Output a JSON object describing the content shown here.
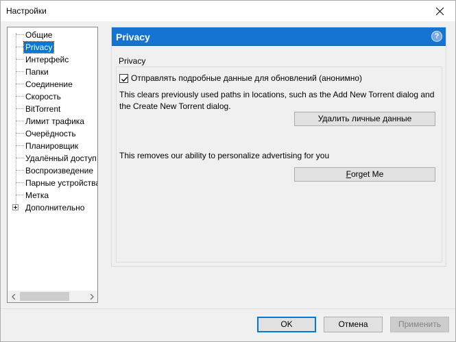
{
  "window": {
    "title": "Настройки"
  },
  "tree": {
    "items": [
      {
        "label": "Общие"
      },
      {
        "label": "Privacy",
        "selected": true
      },
      {
        "label": "Интерфейс"
      },
      {
        "label": "Папки"
      },
      {
        "label": "Соединение"
      },
      {
        "label": "Скорость"
      },
      {
        "label": "BitTorrent"
      },
      {
        "label": "Лимит трафика"
      },
      {
        "label": "Очерёдность"
      },
      {
        "label": "Планировщик"
      },
      {
        "label": "Удалённый доступ"
      },
      {
        "label": "Воспроизведение"
      },
      {
        "label": "Парные устройства"
      },
      {
        "label": "Метка"
      },
      {
        "label": "Дополнительно",
        "expandable": true
      }
    ]
  },
  "pane": {
    "header_title": "Privacy",
    "help_glyph": "?",
    "group_legend": "Privacy",
    "checkbox_label": "Отправлять подробные данные для обновлений (анонимно)",
    "checkbox_checked": true,
    "clear_desc": "This clears previously used paths in locations, such as the Add New Torrent dialog and the Create New Torrent dialog.",
    "clear_button": "Удалить личные данные",
    "ad_desc": "This removes our ability to personalize advertising for you",
    "forget_button_underlined": "F",
    "forget_button_rest": "orget Me"
  },
  "footer": {
    "ok": "OK",
    "cancel": "Отмена",
    "apply": "Применить"
  },
  "colors": {
    "header_bg": "#1573d1",
    "selection": "#0078d7",
    "default_button_border": "#0078d7"
  }
}
